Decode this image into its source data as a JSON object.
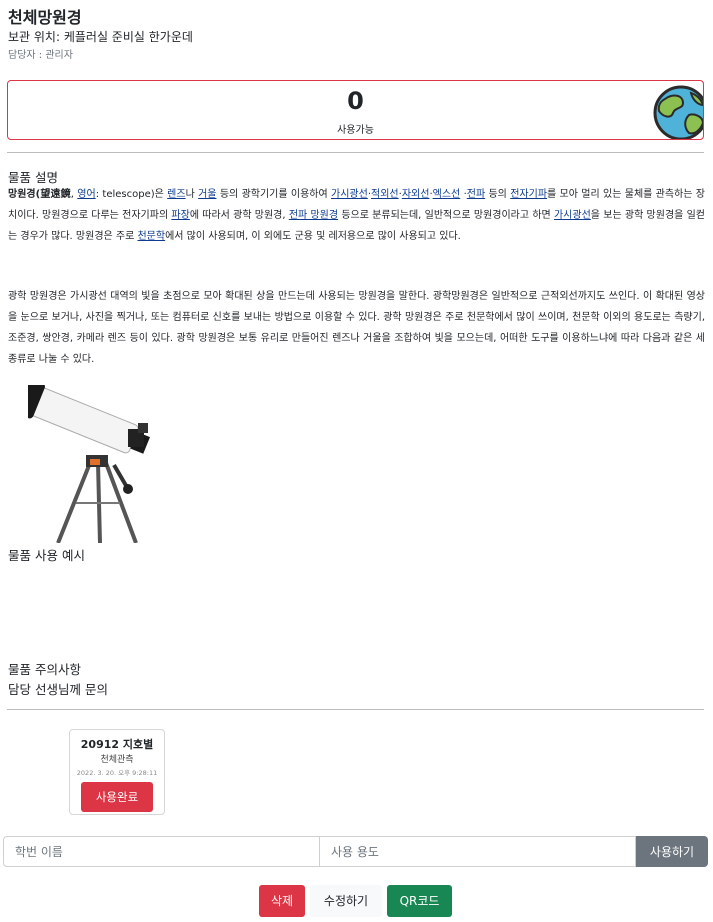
{
  "header": {
    "title": "천체망원경",
    "location": "보관 위치: 케플러실 준비실 한가운데",
    "manager": "담당자 : 관리자"
  },
  "status": {
    "count": "0",
    "label": "사용가능"
  },
  "description": {
    "title": "물품 설명",
    "p1": {
      "t0": "망원경(",
      "t1": "望遠鏡",
      "t2": ", ",
      "l1": "영어",
      "t3": ": telescope)은 ",
      "l2": "렌즈",
      "t4": "나 ",
      "l3": "거울",
      "t5": " 등의 광학기기를 이용하여 ",
      "l4": "가시광선",
      "t6": "·",
      "l5": "적외선",
      "t7": "·",
      "l6": "자외선",
      "t8": "·",
      "l7": "엑스선",
      "t9": " ·",
      "l8": "전파",
      "t10": " 등의 ",
      "l9": "전자기파",
      "t11": "를 모아 멀리 있는 물체를 관측하는 장치이다. 망원경으로 다루는 전자기파의 ",
      "l10": "파장",
      "t12": "에 따라서 광학 망원경, ",
      "l11": "전파 망원경",
      "t13": " 등으로 분류되는데, 일반적으로 망원경이라고 하면 ",
      "l12": "가시광선",
      "t14": "을 보는 광학 망원경을 일컫는 경우가 많다. 망원경은 주로 ",
      "l13": "천문학",
      "t15": "에서 많이 사용되며, 이 외에도 군용 및 레저용으로 많이 사용되고 있다."
    },
    "p2": "광학 망원경은 가시광선 대역의 빛을 초점으로 모아 확대된 상을 만드는데 사용되는 망원경을 말한다. 광학망원경은 일반적으로 근적외선까지도 쓰인다. 이 확대된 영상을 눈으로 보거나, 사진을 찍거나, 또는 컴퓨터로 신호를 보내는 방법으로 이용할 수 있다. 광학 망원경은 주로 천문학에서 많이 쓰이며, 천문학 이외의 용도로는 측량기, 조준경, 쌍안경, 카메라 렌즈 등이 있다. 광학 망원경은 보통 유리로 만들어진 렌즈나 거울을 조합하여 빛을 모으는데, 어떠한 도구를 이용하느냐에 따라 다음과 같은 세 종류로 나눌 수 있다."
  },
  "usage_example": {
    "title": "물품 사용 예시"
  },
  "caution": {
    "title": "물품 주의사항",
    "text": "담당 선생님께 문의"
  },
  "history": [
    {
      "student": "20912 지호별",
      "purpose": "천체관측",
      "time": "2022. 3. 20. 오후 9:28:11",
      "button": "사용완료"
    }
  ],
  "form": {
    "student_placeholder": "학번 이름",
    "purpose_placeholder": "사용 용도",
    "submit_label": "사용하기"
  },
  "actions": {
    "delete_label": "삭제",
    "edit_label": "수정하기",
    "qr_label": "QR코드"
  },
  "colors": {
    "danger": "#dc3545",
    "success": "#198754",
    "secondary": "#6c757d"
  }
}
